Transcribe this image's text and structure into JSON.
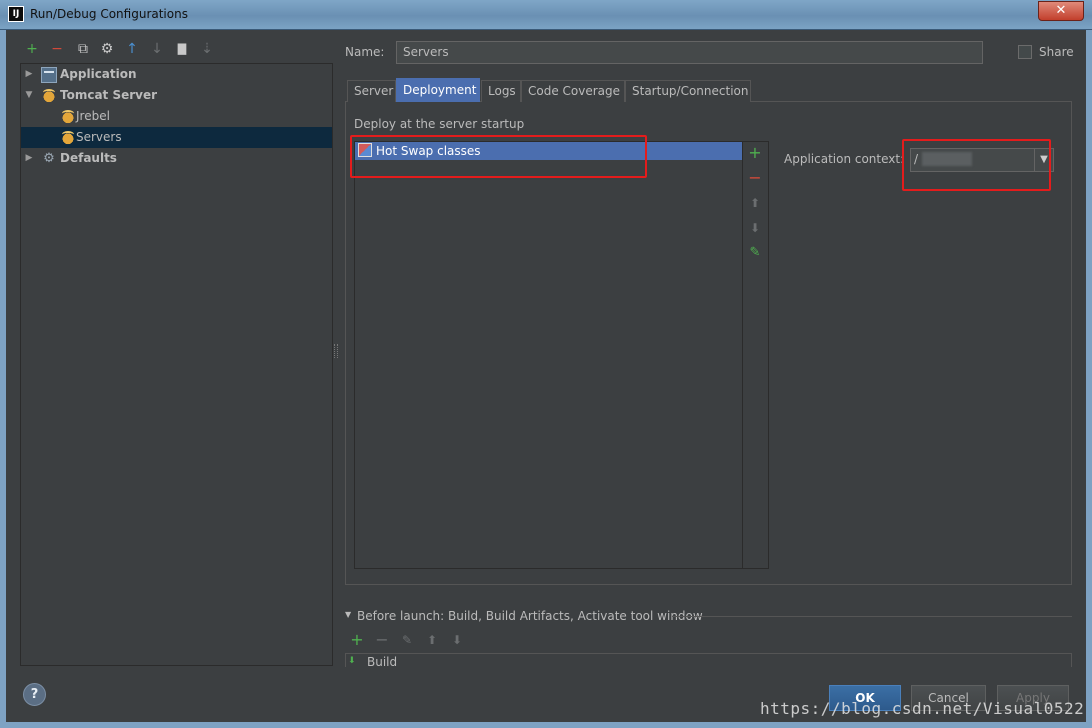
{
  "window": {
    "title": "Run/Debug Configurations",
    "app_icon_letter": "IJ",
    "close_glyph": "✕"
  },
  "toolbar": {
    "add": "+",
    "remove": "−",
    "copy": "⧉",
    "edit_defaults": "⚙",
    "move_up": "↑",
    "move_down": "↓",
    "folder": "▇",
    "sort": "⇣"
  },
  "tree": {
    "items": [
      {
        "label": "Application",
        "expanded": false,
        "bold": true,
        "icon": "application-icon"
      },
      {
        "label": "Tomcat Server",
        "expanded": true,
        "bold": true,
        "icon": "tomcat-icon"
      },
      {
        "label": "Jrebel",
        "bold": false,
        "icon": "tomcat-icon"
      },
      {
        "label": "Servers",
        "bold": false,
        "selected": true,
        "icon": "tomcat-icon"
      },
      {
        "label": "Defaults",
        "expanded": false,
        "bold": true,
        "icon": "defaults-icon"
      }
    ],
    "arrow_collapsed": "▶",
    "arrow_expanded": "▼",
    "defaults_glyph": "⚙"
  },
  "name": {
    "label": "Name:",
    "value": "Servers"
  },
  "share": {
    "label": "Share",
    "checked": false
  },
  "tabs": [
    {
      "label": "Server",
      "active": false
    },
    {
      "label": "Deployment",
      "active": true
    },
    {
      "label": "Logs",
      "active": false
    },
    {
      "label": "Code Coverage",
      "active": false
    },
    {
      "label": "Startup/Connection",
      "active": false
    }
  ],
  "deployment": {
    "section_label": "Deploy at the server startup",
    "items": [
      {
        "label": "Hot Swap classes",
        "selected": true
      }
    ],
    "list_tools": {
      "add": "+",
      "remove": "−",
      "up": "⬆",
      "down": "⬇",
      "edit": "✎"
    },
    "app_context_label": "Application context:",
    "app_context_value": "/",
    "combo_arrow": "▼"
  },
  "before_launch": {
    "label": "Before launch: Build, Build Artifacts, Activate tool window",
    "expand_glyph": "▼",
    "tools": {
      "add": "+",
      "remove": "−",
      "edit": "✎",
      "up": "⬆",
      "down": "⬇"
    },
    "items": [
      {
        "label": "Build"
      }
    ],
    "build_icon_glyph": "⬇"
  },
  "footer": {
    "help": "?",
    "ok": "OK",
    "cancel": "Cancel",
    "apply": "Apply"
  },
  "watermark": "https://blog.csdn.net/Visual0522",
  "colors": {
    "background": "#3c3f41",
    "selection": "#4b6eaf",
    "tree_selection": "#0d293e",
    "highlight": "#e41c1c",
    "add_green": "#4fb04f",
    "remove_red": "#d64a3a"
  }
}
